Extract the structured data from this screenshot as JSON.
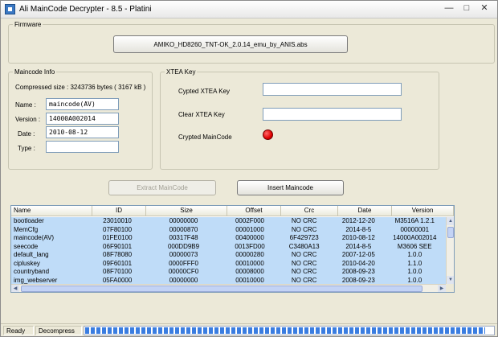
{
  "window": {
    "title": "Ali MainCode Decrypter - 8.5 - Platini"
  },
  "firmware": {
    "legend": "Firmware",
    "file_button": "AMIKO_HD8260_TNT-OK_2.0.14_emu_by_ANIS.abs"
  },
  "maincode_info": {
    "legend": "Maincode Info",
    "compressed_size": "Compressed size : 3243736 bytes ( 3167 kB )",
    "name_label": "Name :",
    "name_value": "maincode(AV)",
    "version_label": "Version :",
    "version_value": "14000A002014",
    "date_label": "Date :",
    "date_value": "2010-08-12",
    "type_label": "Type :",
    "type_value": ""
  },
  "xtea": {
    "legend": "XTEA Key",
    "crypted_key_label": "Cypted XTEA Key",
    "crypted_key_value": "",
    "clear_key_label": "Clear XTEA Key",
    "clear_key_value": "",
    "crypted_maincode_label": "Crypted MainCode",
    "crypted_maincode_status_color": "#e00000"
  },
  "buttons": {
    "extract": "Extract MainCode",
    "insert": "Insert Maincode"
  },
  "table": {
    "columns": [
      "Name",
      "ID",
      "Size",
      "Offset",
      "Crc",
      "Date",
      "Version"
    ],
    "rows": [
      [
        "bootloader",
        "23010010",
        "00000000",
        "0002F000",
        "NO CRC",
        "2012-12-20",
        "M3516A 1.2.1"
      ],
      [
        "MemCfg",
        "07F80100",
        "00000870",
        "00001000",
        "NO CRC",
        "2014-8-5",
        "00000001"
      ],
      [
        "maincode(AV)",
        "01FE0100",
        "00317F48",
        "00400000",
        "6F429723",
        "2010-08-12",
        "14000A002014"
      ],
      [
        "seecode",
        "06F90101",
        "000DD9B9",
        "0013FD00",
        "C3480A13",
        "2014-8-5",
        "M3606 SEE"
      ],
      [
        "default_lang",
        "08F78080",
        "00000073",
        "00000280",
        "NO CRC",
        "2007-12-05",
        "1.0.0"
      ],
      [
        "cipluskey",
        "09F60101",
        "0000FFF0",
        "00010000",
        "NO CRC",
        "2010-04-20",
        "1.1.0"
      ],
      [
        "countryband",
        "08F70100",
        "00000CF0",
        "00008000",
        "NO CRC",
        "2008-09-23",
        "1.0.0"
      ],
      [
        "img_webserver",
        "05FA0000",
        "00000000",
        "00010000",
        "NO CRC",
        "2008-09-23",
        "1.0.0"
      ]
    ]
  },
  "statusbar": {
    "status": "Ready",
    "operation": "Decompress",
    "progress": 0.98,
    "progress_color": "#3a7de0"
  }
}
